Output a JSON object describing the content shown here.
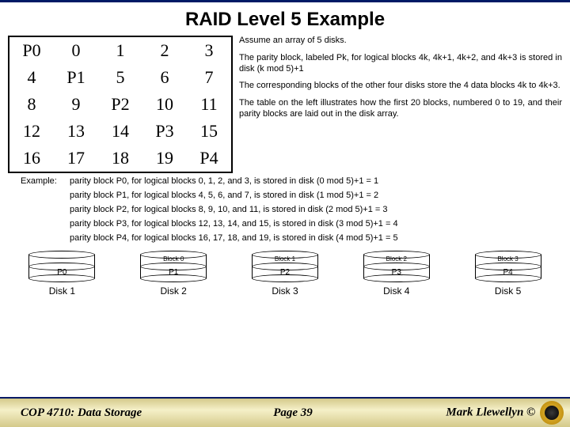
{
  "title": "RAID Level 5 Example",
  "matrix": {
    "rows": [
      [
        "P0",
        "0",
        "1",
        "2",
        "3"
      ],
      [
        "4",
        "P1",
        "5",
        "6",
        "7"
      ],
      [
        "8",
        "9",
        "P2",
        "10",
        "11"
      ],
      [
        "12",
        "13",
        "14",
        "P3",
        "15"
      ],
      [
        "16",
        "17",
        "18",
        "19",
        "P4"
      ]
    ]
  },
  "bullets": [
    "Assume an array of 5 disks.",
    "The parity block, labeled Pk, for logical blocks 4k, 4k+1, 4k+2, and 4k+3 is stored in disk (k mod 5)+1",
    "The corresponding blocks of the other four disks store the 4 data blocks 4k to 4k+3.",
    "The table on the left illustrates how the first 20 blocks, numbered 0 to 19, and their parity blocks are laid out in the disk array."
  ],
  "examples": {
    "label": "Example:",
    "lines": [
      "parity block P0, for logical blocks 0, 1, 2, and 3, is stored in disk (0 mod 5)+1 = 1",
      "parity block P1, for logical blocks 4, 5, 6, and 7, is stored in disk (1 mod 5)+1 = 2",
      "parity block P2, for logical blocks 8, 9, 10, and 11, is stored in disk (2 mod 5)+1 = 3",
      "parity block P3, for logical blocks 12, 13, 14, and 15, is stored in disk (3 mod 5)+1 = 4",
      "parity block P4, for logical blocks 16, 17, 18, and 19, is stored in disk (4 mod 5)+1 = 5"
    ]
  },
  "disks": [
    {
      "top": "",
      "mid": "P0",
      "label": "Disk 1"
    },
    {
      "top": "Block 0",
      "mid": "P1",
      "label": "Disk 2"
    },
    {
      "top": "Block 1",
      "mid": "P2",
      "label": "Disk 3"
    },
    {
      "top": "Block 2",
      "mid": "P3",
      "label": "Disk 4"
    },
    {
      "top": "Block 3",
      "mid": "P4",
      "label": "Disk 5"
    }
  ],
  "footer": {
    "left": "COP 4710: Data Storage",
    "center": "Page 39",
    "right": "Mark Llewellyn ©"
  }
}
